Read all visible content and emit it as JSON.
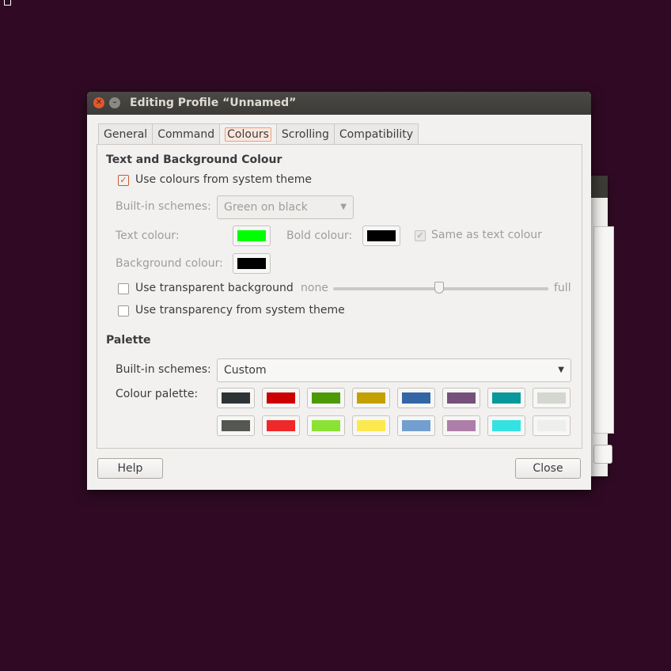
{
  "window": {
    "title": "Editing Profile “Unnamed”"
  },
  "tabs": [
    {
      "label": "General"
    },
    {
      "label": "Command"
    },
    {
      "label": "Colours"
    },
    {
      "label": "Scrolling"
    },
    {
      "label": "Compatibility"
    }
  ],
  "text_bg": {
    "header": "Text and Background Colour",
    "use_system_colours": {
      "label": "Use colours from system theme",
      "checked": true
    },
    "builtin_label": "Built-in schemes:",
    "builtin_value": "Green on black",
    "text_colour_label": "Text colour:",
    "text_colour": "#00ff00",
    "bold_colour_label": "Bold colour:",
    "bold_colour": "#000000",
    "same_as_text": {
      "label": "Same as text colour",
      "checked": true
    },
    "bg_colour_label": "Background colour:",
    "bg_colour": "#000000",
    "transparent_bg": {
      "label": "Use transparent background",
      "checked": false
    },
    "slider_min": "none",
    "slider_max": "full",
    "slider_value": 0.5,
    "transparency_system": {
      "label": "Use transparency from system theme",
      "checked": false
    }
  },
  "palette": {
    "header": "Palette",
    "builtin_label": "Built-in schemes:",
    "builtin_value": "Custom",
    "colour_palette_label": "Colour palette:",
    "row1": [
      "#2e3436",
      "#cc0000",
      "#4e9a06",
      "#c4a000",
      "#3465a4",
      "#75507b",
      "#06989a",
      "#d3d7cf"
    ],
    "row2": [
      "#555753",
      "#ef2929",
      "#8ae234",
      "#fce94f",
      "#729fcf",
      "#ad7fa8",
      "#34e2e2",
      "#eeeeec"
    ]
  },
  "buttons": {
    "help": "Help",
    "close": "Close"
  }
}
